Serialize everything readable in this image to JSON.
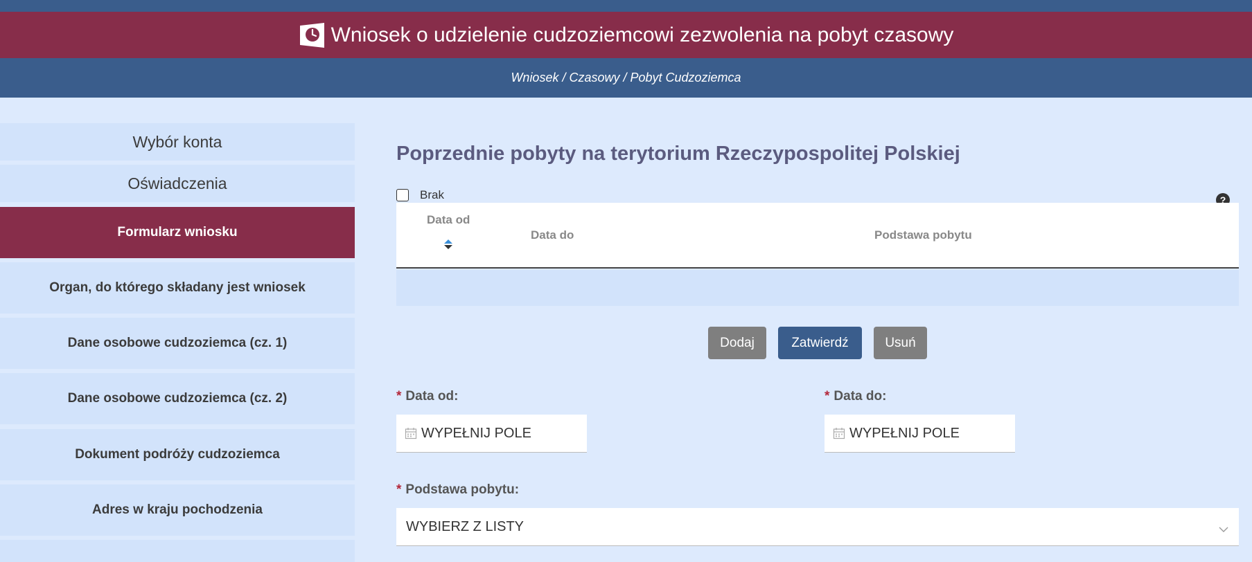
{
  "header": {
    "title": "Wniosek o udzielenie cudzoziemcowi zezwolenia na pobyt czasowy",
    "breadcrumb": "Wniosek / Czasowy / Pobyt Cudzoziemca"
  },
  "sidebar": {
    "items": [
      {
        "label": "Wybór konta",
        "state": "top"
      },
      {
        "label": "Oświadczenia",
        "state": "top"
      },
      {
        "label": "Formularz wniosku",
        "state": "active"
      },
      {
        "label": "Organ, do którego składany jest wniosek",
        "state": "sub"
      },
      {
        "label": "Dane osobowe cudzoziemca (cz. 1)",
        "state": "sub"
      },
      {
        "label": "Dane osobowe cudzoziemca (cz. 2)",
        "state": "sub"
      },
      {
        "label": "Dokument podróży cudzoziemca",
        "state": "sub"
      },
      {
        "label": "Adres w kraju pochodzenia",
        "state": "sub"
      }
    ]
  },
  "main": {
    "section_title": "Poprzednie pobyty na terytorium Rzeczypospolitej Polskiej",
    "brak_label": "Brak",
    "brak_checked": false,
    "help_icon": "?",
    "table": {
      "columns": [
        "Data od",
        "Data do",
        "Podstawa pobytu"
      ],
      "rows": []
    },
    "buttons": {
      "add": "Dodaj",
      "confirm": "Zatwierdź",
      "remove": "Usuń"
    },
    "fields": {
      "required_mark": "*",
      "date_from_label": "Data od:",
      "date_from_value": "WYPEŁNIJ POLE",
      "date_to_label": "Data do:",
      "date_to_value": "WYPEŁNIJ POLE",
      "basis_label": "Podstawa pobytu:",
      "basis_value": "WYBIERZ Z LISTY"
    }
  },
  "colors": {
    "brand_maroon": "#872d4a",
    "brand_blue": "#3a5d8c",
    "background": "#ddeafd",
    "sidebar_bg": "#d2e3fb",
    "button_grey": "#7f7f7f",
    "required": "#b3273a"
  },
  "icons": {
    "logo": "calendar-clock-icon",
    "sort": "sort-icon",
    "calendar": "calendar-icon",
    "dropdown": "chevron-down-icon",
    "help": "help-icon"
  }
}
